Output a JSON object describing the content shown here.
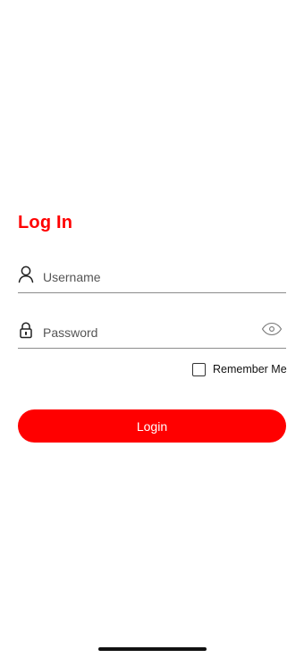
{
  "login": {
    "title": "Log In",
    "username": {
      "placeholder": "Username",
      "value": "",
      "icon": "user-icon"
    },
    "password": {
      "placeholder": "Password",
      "value": "",
      "icon": "lock-icon",
      "toggle_icon": "eye-icon"
    },
    "remember_me": {
      "label": "Remember Me",
      "checked": false
    },
    "button_label": "Login"
  },
  "colors": {
    "accent": "#ff0000",
    "underline": "#8c8c8c",
    "background": "#ffffff"
  }
}
